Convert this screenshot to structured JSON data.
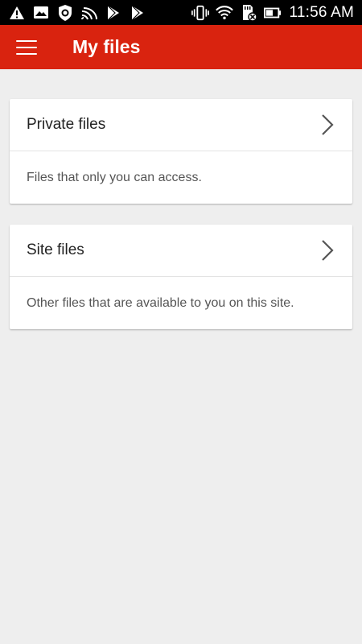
{
  "status_bar": {
    "time": "11:56 AM",
    "left_icons": [
      "warning-icon",
      "photo-icon",
      "shield-icon",
      "cast-icon",
      "play-store-icon",
      "play-store-icon-2"
    ],
    "right_icons": [
      "vibrate-icon",
      "wifi-icon",
      "sd-card-icon",
      "battery-icon"
    ]
  },
  "app_bar": {
    "title": "My files",
    "menu_icon": "hamburger-menu-icon",
    "color": "#d9230f"
  },
  "cards": [
    {
      "title": "Private files",
      "description": "Files that only you can access.",
      "icon": "chevron-right-icon"
    },
    {
      "title": "Site files",
      "description": "Other files that are available to you on this site.",
      "icon": "chevron-right-icon"
    }
  ]
}
